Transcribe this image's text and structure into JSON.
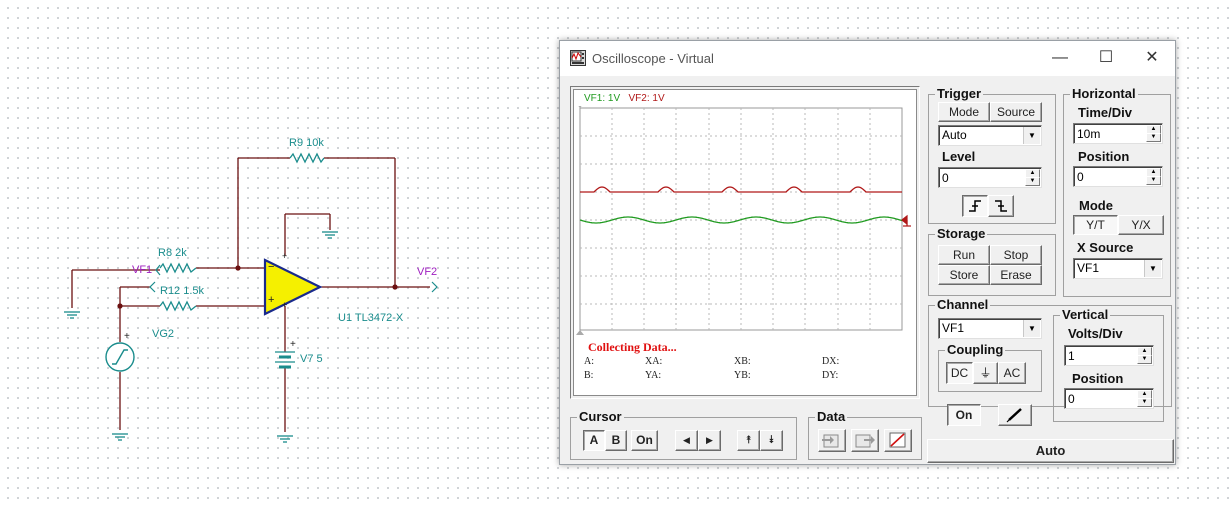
{
  "schematic": {
    "r9_label": "R9 10k",
    "r8_label": "R8 2k",
    "r12_label": "R12 1.5k",
    "vf1_label": "VF1",
    "vf2_label": "VF2",
    "vg2_label": "VG2",
    "opamp_label": "U1 TL3472-X",
    "v7_label": "V7 5",
    "plus_sign": "+",
    "minus_sign": "−"
  },
  "window": {
    "title": "Oscilloscope - Virtual",
    "minimize": "—",
    "maximize": "☐",
    "close": "✕"
  },
  "screen": {
    "vf1_scale": "VF1: 1V",
    "vf2_scale": "VF2: 1V",
    "status": "Collecting Data...",
    "measures": {
      "a": "A:",
      "xa": "XA:",
      "xb": "XB:",
      "dx": "DX:",
      "b": "B:",
      "ya": "YA:",
      "yb": "YB:",
      "dy": "DY:"
    },
    "colors": {
      "vf1": "#1f9a1f",
      "vf2": "#b01818"
    }
  },
  "trigger": {
    "title": "Trigger",
    "mode_btn": "Mode",
    "source_btn": "Source",
    "mode_value": "Auto",
    "level_label": "Level",
    "level_value": "0"
  },
  "horizontal": {
    "title": "Horizontal",
    "time_div_label": "Time/Div",
    "time_div_value": "10m",
    "position_label": "Position",
    "position_value": "0",
    "mode_label": "Mode",
    "yt_btn": "Y/T",
    "yx_btn": "Y/X",
    "xsource_label": "X Source",
    "xsource_value": "VF1"
  },
  "storage": {
    "title": "Storage",
    "run": "Run",
    "stop": "Stop",
    "store": "Store",
    "erase": "Erase"
  },
  "channel": {
    "title": "Channel",
    "value": "VF1",
    "coupling_title": "Coupling",
    "dc": "DC",
    "gnd": "⏚",
    "ac": "AC",
    "on_btn": "On"
  },
  "vertical": {
    "title": "Vertical",
    "volts_div_label": "Volts/Div",
    "volts_div_value": "1",
    "position_label": "Position",
    "position_value": "0"
  },
  "cursor": {
    "title": "Cursor",
    "a": "A",
    "b": "B",
    "on": "On",
    "left": "◀",
    "right": "▶",
    "up": "⯭",
    "down": "⯯"
  },
  "data_group": {
    "title": "Data"
  },
  "auto_button": "Auto"
}
